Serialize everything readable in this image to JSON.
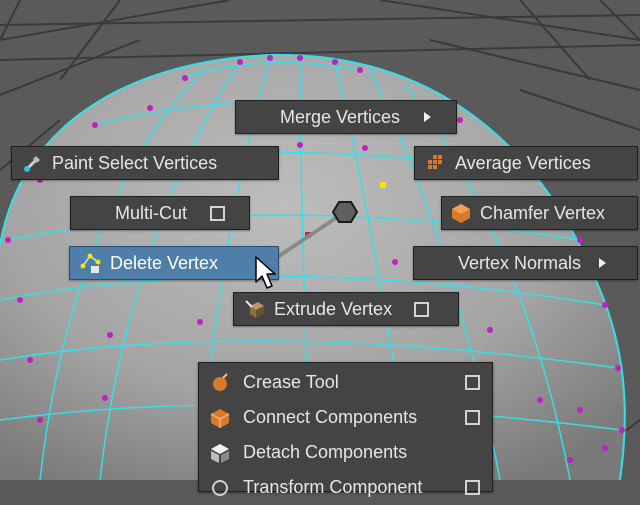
{
  "marking_menu": {
    "north": {
      "label": "Merge Vertices",
      "has_submenu": true
    },
    "northwest": {
      "label": "Paint Select Vertices",
      "icon": "paint-select-icon"
    },
    "northeast": {
      "label": "Average Vertices",
      "icon": "average-vertices-icon"
    },
    "west": {
      "label": "Multi-Cut",
      "has_options": true
    },
    "east": {
      "label": "Chamfer Vertex",
      "icon": "chamfer-vertex-icon"
    },
    "southwest": {
      "label": "Delete Vertex",
      "icon": "delete-vertex-icon",
      "highlighted": true
    },
    "southeast": {
      "label": "Vertex Normals",
      "has_submenu": true
    },
    "south": {
      "label": "Extrude Vertex",
      "icon": "extrude-vertex-icon",
      "has_options": true
    }
  },
  "overflow_menu": {
    "items": [
      {
        "label": "Crease Tool",
        "icon": "crease-tool-icon",
        "has_options": true
      },
      {
        "label": "Connect Components",
        "icon": "connect-components-icon",
        "has_options": true
      },
      {
        "label": "Detach Components",
        "icon": "detach-components-icon",
        "has_options": false
      },
      {
        "label": "Transform Component",
        "icon": "transform-component-icon",
        "has_options": true
      }
    ]
  },
  "colors": {
    "viewport_background": "#5a5a5a",
    "wireframe": "#33e0e8",
    "vertex": "#c020c0",
    "selected_vertex": "#ffe000",
    "menu_background": "#444444",
    "menu_highlight": "#4f7fa8",
    "menu_text": "#e6e6e6"
  }
}
